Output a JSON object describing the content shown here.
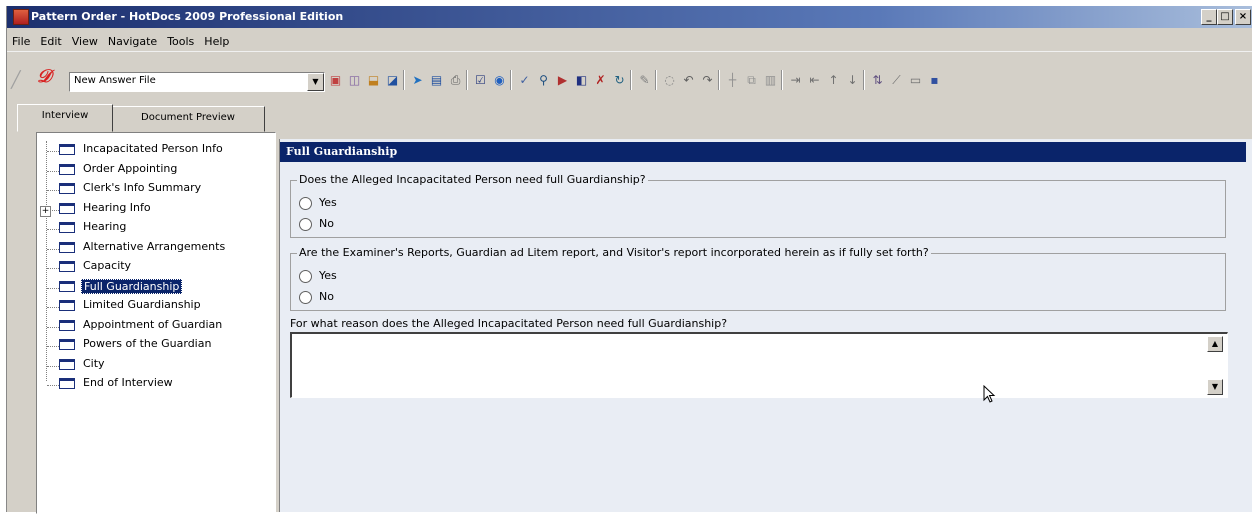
{
  "window": {
    "title": "Pattern Order - HotDocs 2009 Professional Edition",
    "controls": [
      "_",
      "□",
      "×"
    ]
  },
  "menu": [
    "File",
    "Edit",
    "View",
    "Navigate",
    "Tools",
    "Help"
  ],
  "toolbar": {
    "answer_file": "New Answer File",
    "icons": [
      "new-answer-file-icon",
      "open-icon",
      "save-icon",
      "save-as-icon",
      "send-icon",
      "save-document-icon",
      "print-icon",
      "properties-icon",
      "help-icon",
      "spell-check-icon",
      "find-icon",
      "assemble-icon",
      "preview-icon",
      "mark-icon",
      "refresh-icon",
      "edit-icon",
      "clear-icon",
      "undo-icon",
      "redo-icon",
      "insert-icon",
      "copy-icon",
      "paste-icon",
      "indent-icon",
      "outdent-icon",
      "move-up-icon",
      "move-down-icon",
      "sort-icon",
      "chart-icon",
      "graph-icon",
      "window-icon"
    ]
  },
  "tabs": [
    {
      "label": "Interview",
      "active": true
    },
    {
      "label": "Document Preview",
      "active": false
    }
  ],
  "tree": {
    "items": [
      {
        "label": "Incapacitated Person Info",
        "selected": false,
        "expandable": false
      },
      {
        "label": "Order Appointing",
        "selected": false,
        "expandable": false
      },
      {
        "label": "Clerk's Info Summary",
        "selected": false,
        "expandable": false
      },
      {
        "label": "Hearing Info",
        "selected": false,
        "expandable": true
      },
      {
        "label": "Hearing",
        "selected": false,
        "expandable": false
      },
      {
        "label": "Alternative Arrangements",
        "selected": false,
        "expandable": false
      },
      {
        "label": "Capacity",
        "selected": false,
        "expandable": false
      },
      {
        "label": "Full Guardianship",
        "selected": true,
        "expandable": false
      },
      {
        "label": "Limited Guardianship",
        "selected": false,
        "expandable": false
      },
      {
        "label": "Appointment of Guardian",
        "selected": false,
        "expandable": false
      },
      {
        "label": "Powers of the Guardian",
        "selected": false,
        "expandable": false
      },
      {
        "label": "City",
        "selected": false,
        "expandable": false
      },
      {
        "label": "End of Interview",
        "selected": false,
        "expandable": false
      }
    ]
  },
  "dialog": {
    "title": "Full Guardianship",
    "q1": {
      "label": "Does the Alleged Incapacitated Person need full Guardianship?",
      "options": [
        "Yes",
        "No"
      ]
    },
    "q2": {
      "label": "Are the Examiner's Reports, Guardian ad Litem report, and Visitor's report incorporated herein as if fully set forth?",
      "options": [
        "Yes",
        "No"
      ]
    },
    "q3": {
      "label": "For what reason does the Alleged Incapacitated Person need full Guardianship?",
      "value": ""
    }
  }
}
